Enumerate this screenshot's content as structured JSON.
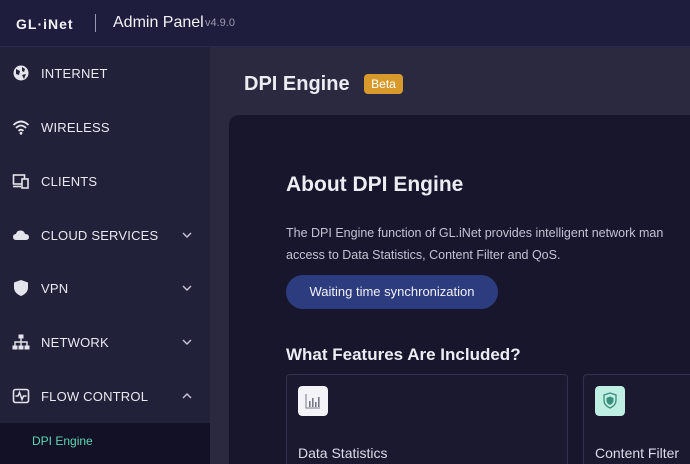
{
  "header": {
    "logo": "GL·iNet",
    "title": "Admin Panel",
    "version": "v4.9.0"
  },
  "sidebar": {
    "items": [
      {
        "label": "INTERNET",
        "icon": "globe-icon"
      },
      {
        "label": "WIRELESS",
        "icon": "wifi-icon"
      },
      {
        "label": "CLIENTS",
        "icon": "devices-icon"
      },
      {
        "label": "CLOUD SERVICES",
        "icon": "cloud-icon",
        "chevron": "down"
      },
      {
        "label": "VPN",
        "icon": "shield-icon",
        "chevron": "down"
      },
      {
        "label": "NETWORK",
        "icon": "network-icon",
        "chevron": "down"
      },
      {
        "label": "FLOW CONTROL",
        "icon": "flow-control-icon",
        "chevron": "up"
      }
    ],
    "active_sub_item": "DPI Engine"
  },
  "main": {
    "page_title": "DPI Engine",
    "badge": "Beta",
    "about_title": "About DPI Engine",
    "description_line1": "The DPI Engine function of GL.iNet provides intelligent network man",
    "description_line2": "access to Data Statistics, Content Filter and QoS.",
    "sync_button": "Waiting time synchronization",
    "features_title": "What Features Are Included?",
    "features": [
      {
        "label": "Data Statistics",
        "icon": "chart-icon"
      },
      {
        "label": "Content Filter",
        "icon": "shield-filter-icon"
      }
    ]
  },
  "colors": {
    "accent_teal": "#5fd4b4",
    "badge_orange": "#d8992c",
    "button_blue": "#2d3c7f"
  }
}
